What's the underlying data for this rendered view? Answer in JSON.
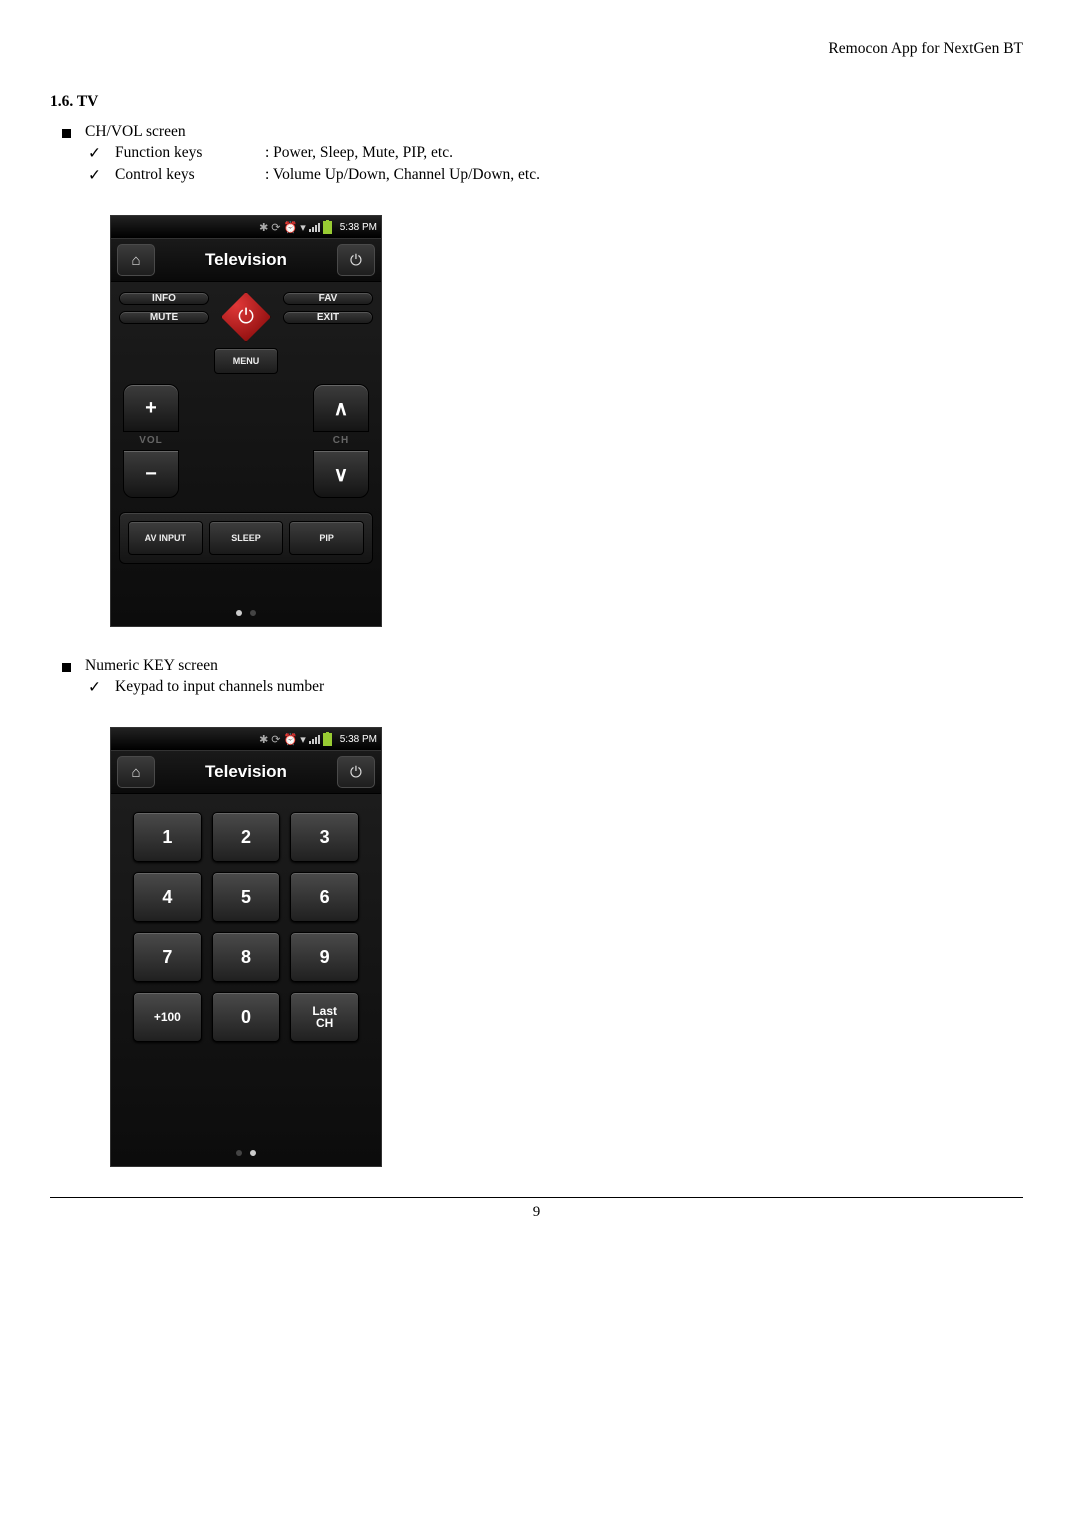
{
  "header": {
    "doc_title": "Remocon App for NextGen BT"
  },
  "section": {
    "heading": "1.6. TV"
  },
  "bullet1": {
    "title": "CH/VOL screen",
    "items": [
      {
        "label": "Function keys",
        "desc": ": Power, Sleep, Mute, PIP, etc."
      },
      {
        "label": "Control keys",
        "desc": ": Volume Up/Down, Channel Up/Down, etc."
      }
    ]
  },
  "bullet2": {
    "title": "Numeric KEY screen",
    "items": [
      {
        "label": "Keypad to input channels number",
        "desc": ""
      }
    ]
  },
  "phone": {
    "status_time": "5:38 PM",
    "title": "Television",
    "buttons": {
      "info": "INFO",
      "fav": "FAV",
      "mute": "MUTE",
      "exit": "EXIT",
      "menu": "MENU",
      "vol_label": "VOL",
      "ch_label": "CH",
      "plus": "+",
      "minus": "−",
      "up": "∧",
      "down": "∨",
      "av": "AV INPUT",
      "sleep": "SLEEP",
      "pip": "PIP"
    },
    "keypad": [
      "1",
      "2",
      "3",
      "4",
      "5",
      "6",
      "7",
      "8",
      "9",
      "+100",
      "0",
      "Last\nCH"
    ]
  },
  "footer": {
    "page": "9"
  }
}
